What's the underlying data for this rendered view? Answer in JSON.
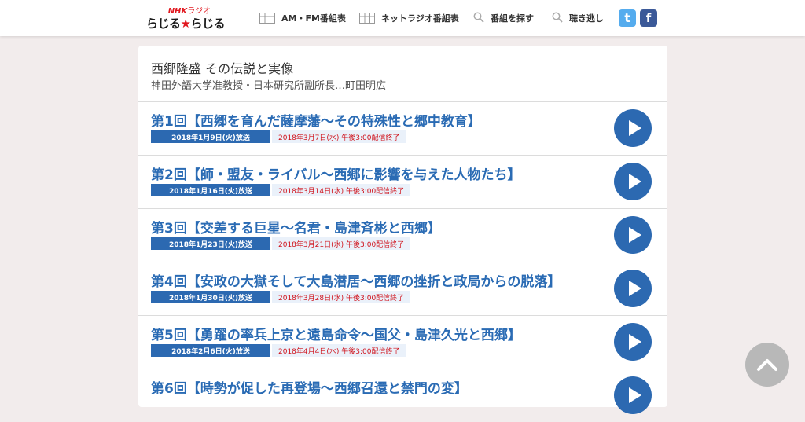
{
  "header": {
    "logo_brand": "NHK",
    "logo_sub": "ラジオ",
    "logo_name_a": "らじる",
    "logo_star": "★",
    "logo_name_b": "らじる",
    "nav": [
      {
        "label": "AM・FM番組表",
        "icon": "grid-icon"
      },
      {
        "label": "ネットラジオ番組表",
        "icon": "grid-icon"
      },
      {
        "label": "番組を探す",
        "icon": "search-icon"
      },
      {
        "label": "聴き逃し",
        "icon": "search-icon"
      }
    ],
    "social": {
      "twitter_glyph": "t",
      "facebook_glyph": "f",
      "twitter_color": "#55acee",
      "facebook_color": "#3b5998"
    }
  },
  "series": {
    "title": "西郷隆盛 その伝説と実像",
    "subtitle": "神田外語大学准教授・日本研究所副所長…町田明広"
  },
  "episodes": [
    {
      "title": "第1回【西郷を育んだ薩摩藩～その特殊性と郷中教育】",
      "air": "2018年1月9日(火)放送",
      "stream": "2018年3月7日(水) 午後3:00配信終了"
    },
    {
      "title": "第2回【師・盟友・ライバル～西郷に影響を与えた人物たち】",
      "air": "2018年1月16日(火)放送",
      "stream": "2018年3月14日(水) 午後3:00配信終了"
    },
    {
      "title": "第3回【交差する巨星～名君・島津斉彬と西郷】",
      "air": "2018年1月23日(火)放送",
      "stream": "2018年3月21日(水) 午後3:00配信終了"
    },
    {
      "title": "第4回【安政の大獄そして大島潜居～西郷の挫折と政局からの脱落】",
      "air": "2018年1月30日(火)放送",
      "stream": "2018年3月28日(水) 午後3:00配信終了"
    },
    {
      "title": "第5回【勇躍の率兵上京と遠島命令～国父・島津久光と西郷】",
      "air": "2018年2月6日(火)放送",
      "stream": "2018年4月4日(水) 午後3:00配信終了"
    },
    {
      "title": "第6回【時勢が促した再登場～西郷召還と禁門の変】",
      "air": "",
      "stream": ""
    }
  ],
  "colors": {
    "accent": "#2c69b1",
    "title_blue": "#2a6bb4",
    "stream_red": "#d0121b",
    "background": "#f2ecec"
  }
}
